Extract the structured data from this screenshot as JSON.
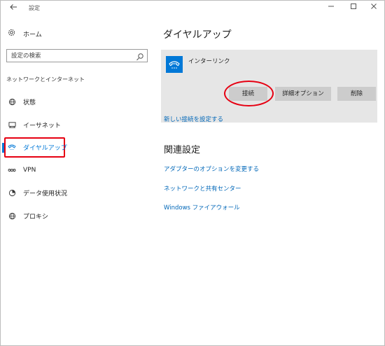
{
  "window": {
    "title": "設定",
    "controls": {
      "back_icon": "back-arrow-icon",
      "minimize": "minimize-icon",
      "maximize": "maximize-icon",
      "close": "close-icon"
    }
  },
  "sidebar": {
    "home_label": "ホーム",
    "search_placeholder": "設定の検索",
    "section_title": "ネットワークとインターネット",
    "items": [
      {
        "label": "状態",
        "icon": "globe-status-icon",
        "active": false
      },
      {
        "label": "イーサネット",
        "icon": "ethernet-icon",
        "active": false
      },
      {
        "label": "ダイヤルアップ",
        "icon": "dialup-phone-icon",
        "active": true
      },
      {
        "label": "VPN",
        "icon": "vpn-icon",
        "active": false
      },
      {
        "label": "データ使用状況",
        "icon": "data-usage-icon",
        "active": false
      },
      {
        "label": "プロキシ",
        "icon": "proxy-globe-icon",
        "active": false
      }
    ]
  },
  "main": {
    "title": "ダイヤルアップ",
    "connection": {
      "name": "インターリンク",
      "buttons": {
        "connect": "接続",
        "advanced": "詳細オプション",
        "delete": "削除"
      }
    },
    "new_connection_link": "新しい接続を設定する",
    "related_title": "関連設定",
    "related_links": [
      "アダプターのオプションを変更する",
      "ネットワークと共有センター",
      "Windows ファイアウォール"
    ]
  },
  "colors": {
    "accent": "#0078d7",
    "link": "#0067b8",
    "highlight": "#e60012",
    "card_bg": "#e6e6e6",
    "button_bg": "#cccccc"
  }
}
